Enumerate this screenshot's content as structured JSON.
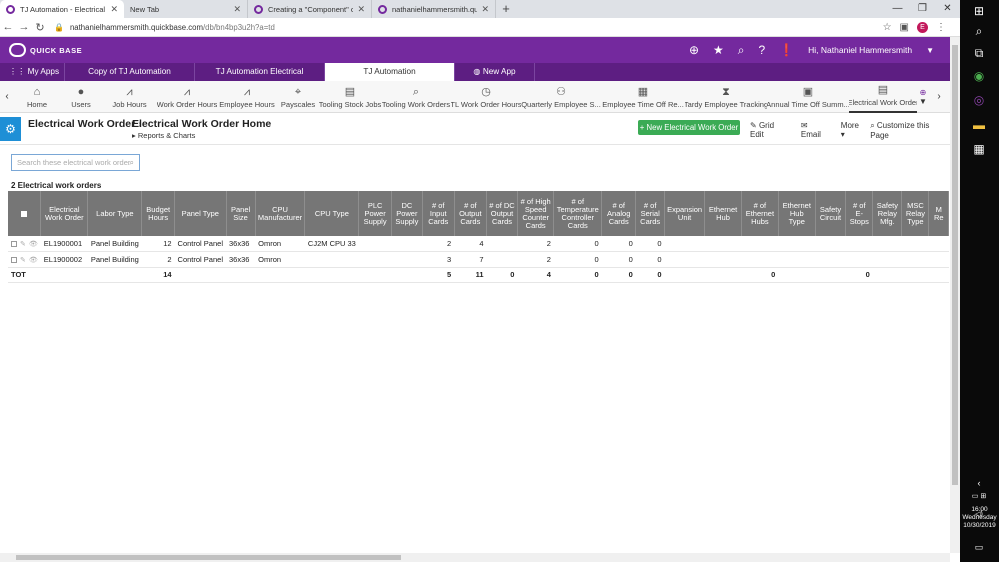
{
  "browser": {
    "tabs": [
      {
        "title": "TJ Automation - Electrical Work O",
        "active": true
      },
      {
        "title": "New Tab",
        "active": false
      },
      {
        "title": "Creating a \"Component\" of with",
        "active": false
      },
      {
        "title": "nathanielhammersmith.quickbas",
        "active": false
      }
    ],
    "new_tab": "+",
    "url_host": "nathanielhammersmith.quickbase.com",
    "url_path": "/db/bn4bp3u2h?a=td",
    "profile_initial": "E"
  },
  "qb": {
    "logo": "QUICK BASE",
    "user_name": "Hi, Nathaniel Hammersmith",
    "app_tabs": [
      {
        "label": "My Apps"
      },
      {
        "label": "Copy of TJ Automation"
      },
      {
        "label": "TJ Automation Electrical"
      },
      {
        "label": "TJ Automation"
      },
      {
        "label": "New App"
      }
    ],
    "tables": [
      {
        "label": "Home",
        "icon": "home-icon"
      },
      {
        "label": "Users",
        "icon": "user-icon"
      },
      {
        "label": "Job Hours",
        "icon": "chart-icon"
      },
      {
        "label": "Work Order Hours",
        "icon": "chart-icon"
      },
      {
        "label": "Employee Hours",
        "icon": "chart-icon"
      },
      {
        "label": "Payscales",
        "icon": "tag-icon"
      },
      {
        "label": "Tooling Stock Jobs",
        "icon": "doc-icon"
      },
      {
        "label": "Tooling Work Orders",
        "icon": "search-icon"
      },
      {
        "label": "TL Work Order Hours",
        "icon": "clock-icon"
      },
      {
        "label": "Quarterly Employee S...",
        "icon": "group-icon"
      },
      {
        "label": "Employee Time Off Re...",
        "icon": "calendar-icon"
      },
      {
        "label": "Tardy Employee Tracking",
        "icon": "hourglass-icon"
      },
      {
        "label": "Annual Time Off Summ...",
        "icon": "clipboard-icon"
      },
      {
        "label": "Electrical Work Order",
        "icon": "doc-icon"
      }
    ]
  },
  "page": {
    "table_name": "Electrical Work Order",
    "page_name": "Electrical Work Order Home",
    "reports_link": "Reports & Charts",
    "new_button": "+ New Electrical Work Order",
    "actions": [
      "Grid Edit",
      "Email",
      "More",
      "Customize this Page"
    ],
    "search_placeholder": "Search these electrical work orders",
    "record_count": "2 Electrical work orders"
  },
  "grid": {
    "columns": [
      "Electrical Work Order",
      "Labor Type",
      "Budget Hours",
      "Panel Type",
      "Panel Size",
      "CPU Manufacturer",
      "CPU Type",
      "PLC Power Supply",
      "DC Power Supply",
      "# of Input Cards",
      "# of Output Cards",
      "# of DC Output Cards",
      "# of High Speed Counter Cards",
      "# of Temperature Controller Cards",
      "# of Analog Cards",
      "# of Serial Cards",
      "Expansion Unit",
      "Ethernet Hub",
      "# of Ethernet Hubs",
      "Ethernet Hub Type",
      "Safety Circuit",
      "# of E-Stops",
      "Safety Relay Mfg.",
      "MSC Relay Type",
      "M Re"
    ],
    "rows": [
      [
        "EL1900001",
        "Panel Building",
        "12",
        "Control Panel",
        "36x36",
        "Omron",
        "CJ2M CPU 33",
        "",
        "",
        "2",
        "4",
        "",
        "2",
        "0",
        "0",
        "0",
        "",
        "",
        "",
        "",
        "",
        "",
        "",
        "",
        ""
      ],
      [
        "EL1900002",
        "Panel Building",
        "2",
        "Control Panel",
        "36x36",
        "Omron",
        "",
        "",
        "",
        "3",
        "7",
        "",
        "2",
        "0",
        "0",
        "0",
        "",
        "",
        "",
        "",
        "",
        "",
        "",
        "",
        ""
      ]
    ],
    "total_label": "TOT",
    "totals": [
      "",
      "",
      "14",
      "",
      "",
      "",
      "",
      "",
      "",
      "5",
      "11",
      "0",
      "4",
      "0",
      "0",
      "0",
      "",
      "",
      "0",
      "",
      "",
      "0",
      "",
      "",
      ""
    ]
  },
  "taskbar": {
    "time": "16:00",
    "day": "Wednesday",
    "date": "10/30/2019"
  }
}
